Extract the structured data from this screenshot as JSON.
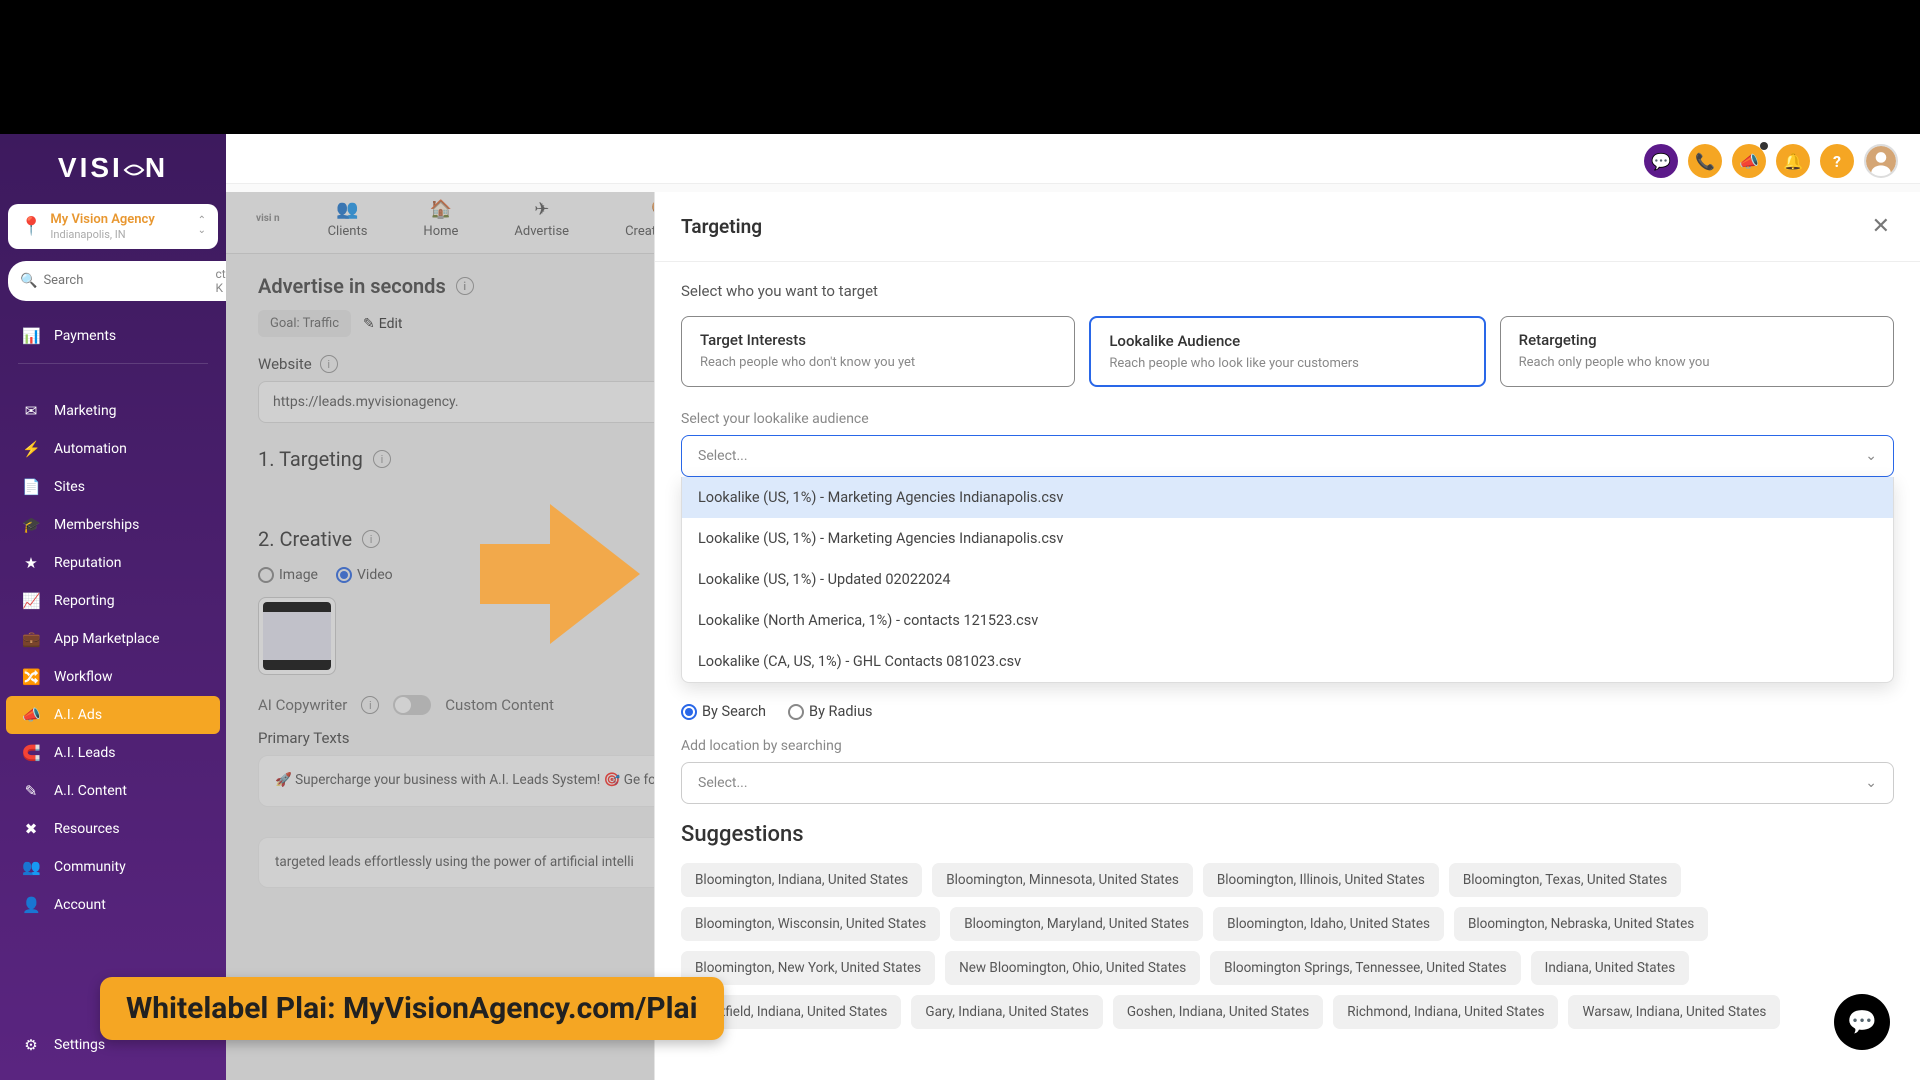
{
  "header_icons": [
    "chat",
    "phone",
    "megaphone",
    "bell",
    "help"
  ],
  "brand": "VISI   N",
  "account": {
    "name": "My Vision Agency",
    "location": "Indianapolis, IN"
  },
  "search": {
    "placeholder": "Search",
    "shortcut": "ctrl K"
  },
  "nav": {
    "items": [
      {
        "icon": "payments",
        "label": "Payments"
      },
      {
        "icon": "marketing",
        "label": "Marketing"
      },
      {
        "icon": "automation",
        "label": "Automation"
      },
      {
        "icon": "sites",
        "label": "Sites"
      },
      {
        "icon": "memberships",
        "label": "Memberships"
      },
      {
        "icon": "reputation",
        "label": "Reputation"
      },
      {
        "icon": "reporting",
        "label": "Reporting"
      },
      {
        "icon": "marketplace",
        "label": "App Marketplace"
      },
      {
        "icon": "workflow",
        "label": "Workflow"
      },
      {
        "icon": "ai-ads",
        "label": "A.I. Ads",
        "active": true
      },
      {
        "icon": "ai-leads",
        "label": "A.I. Leads"
      },
      {
        "icon": "ai-content",
        "label": "A.I. Content"
      },
      {
        "icon": "resources",
        "label": "Resources"
      },
      {
        "icon": "community",
        "label": "Community"
      },
      {
        "icon": "account",
        "label": "Account"
      }
    ],
    "settings": {
      "icon": "settings",
      "label": "Settings"
    }
  },
  "subnav": {
    "logo": "visi n",
    "items": [
      {
        "icon": "👥",
        "label": "Clients"
      },
      {
        "icon": "🏠",
        "label": "Home"
      },
      {
        "icon": "✈",
        "label": "Advertise"
      },
      {
        "icon": "🎨",
        "label": "Creative Hub"
      }
    ]
  },
  "page": {
    "title": "Advertise in seconds",
    "goal_label": "Goal: Traffic",
    "edit": "Edit",
    "website_label": "Website",
    "website_value": "https://leads.myvisionagency.",
    "targeting_head": "1.  Targeting",
    "creative_head": "2. Creative",
    "creative_radio": {
      "image": "Image",
      "video": "Video"
    },
    "ai_copywriter": "AI Copywriter",
    "custom_content": "Custom Content",
    "primary_texts_label": "Primary Texts",
    "primary_texts": "🚀 Supercharge your business with A.I. Leads System! 🎯 Ge                                                   for your business using the power of artificial intelligence. 🤖                                                                                                                irrelevant leads. Let our revolutionary platform find the most                                                           💼 Experience the future of lead generation today!",
    "primary_line2": "targeted leads effortlessly using the power of artificial intelli"
  },
  "panel": {
    "title": "Targeting",
    "subhead": "Select who you want to target",
    "cards": [
      {
        "title": "Target Interests",
        "sub": "Reach people who don't know you yet"
      },
      {
        "title": "Lookalike Audience",
        "sub": "Reach people who look like your customers",
        "selected": true
      },
      {
        "title": "Retargeting",
        "sub": "Reach only people who know you"
      }
    ],
    "lookalike_label": "Select your lookalike audience",
    "select_placeholder": "Select...",
    "dropdown": [
      "Lookalike (US, 1%) - Marketing Agencies Indianapolis.csv",
      "Lookalike (US, 1%) - Marketing Agencies Indianapolis.csv",
      "Lookalike (US, 1%) - Updated 02022024",
      "Lookalike (North America, 1%) - contacts 121523.csv",
      "Lookalike (CA, US, 1%) - GHL Contacts 081023.csv"
    ],
    "by_search": "By Search",
    "by_radius": "By Radius",
    "location_label": "Add location by searching",
    "suggestions_title": "Suggestions",
    "chips": [
      "Bloomington, Indiana, United States",
      "Bloomington, Minnesota, United States",
      "Bloomington, Illinois, United States",
      "Bloomington, Texas, United States",
      "Bloomington, Wisconsin, United States",
      "Bloomington, Maryland, United States",
      "Bloomington, Idaho, United States",
      "Bloomington, Nebraska, United States",
      "Bloomington, New York, United States",
      "New Bloomington, Ohio, United States",
      "Bloomington Springs, Tennessee, United States",
      "Indiana, United States",
      "Westfield, Indiana, United States",
      "Gary, Indiana, United States",
      "Goshen, Indiana, United States",
      "Richmond, Indiana, United States",
      "Warsaw, Indiana, United States"
    ]
  },
  "banner": "Whitelabel Plai: MyVisionAgency.com/Plai",
  "icons": {
    "payments": "📊",
    "marketing": "✉",
    "automation": "⚡",
    "sites": "📄",
    "memberships": "🎓",
    "reputation": "★",
    "reporting": "📈",
    "marketplace": "💼",
    "workflow": "🔀",
    "ai-ads": "📣",
    "ai-leads": "🧲",
    "ai-content": "✎",
    "resources": "✖",
    "community": "👥",
    "account": "👤",
    "settings": "⚙"
  }
}
